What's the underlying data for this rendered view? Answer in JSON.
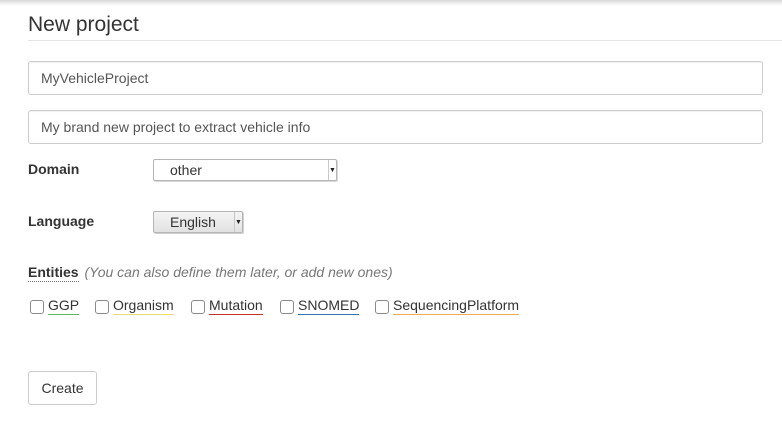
{
  "page": {
    "title": "New project"
  },
  "form": {
    "name_value": "MyVehicleProject",
    "description_value": "My brand new project to extract vehicle info",
    "domain_label": "Domain",
    "domain_value": "other",
    "language_label": "Language",
    "language_value": "English",
    "entities_label": "Entities",
    "entities_hint": "(You can also define them later, or add new ones)",
    "entities": [
      {
        "label": "GGP",
        "checked": false,
        "color": "#5cb85c"
      },
      {
        "label": "Organism",
        "checked": false,
        "color": "#e8e070"
      },
      {
        "label": "Mutation",
        "checked": false,
        "color": "#c9302c"
      },
      {
        "label": "SNOMED",
        "checked": false,
        "color": "#3a6fb0"
      },
      {
        "label": "SequencingPlatform",
        "checked": false,
        "color": "#f0ad4e"
      }
    ],
    "create_label": "Create"
  }
}
